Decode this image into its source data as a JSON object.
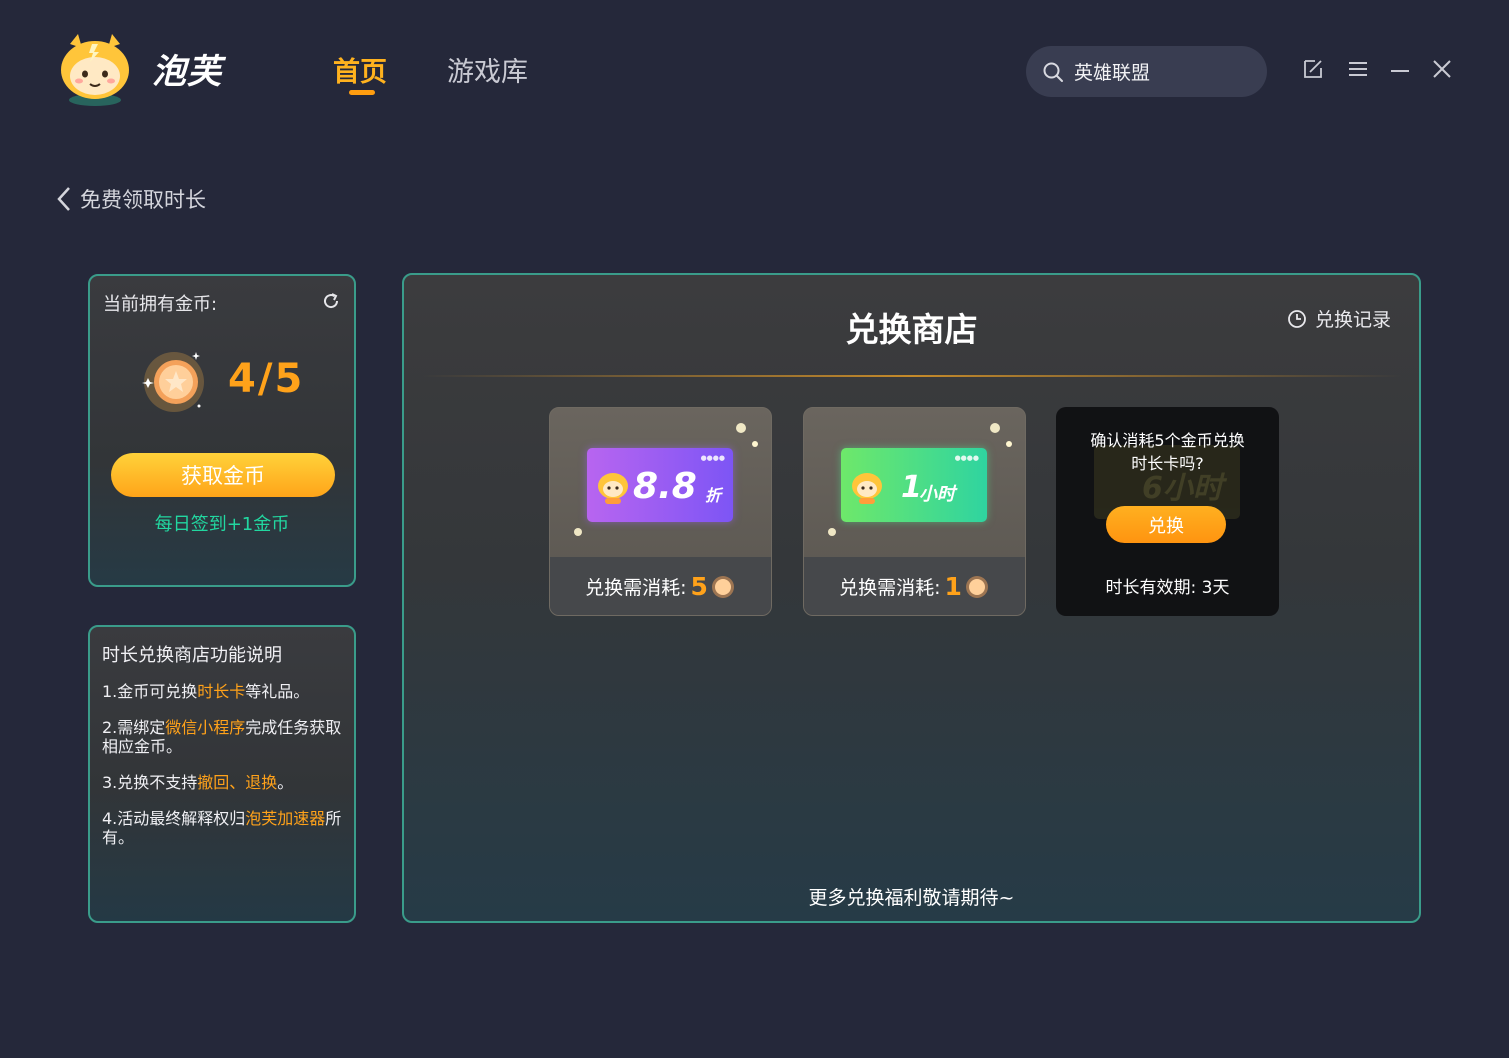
{
  "header": {
    "brand": "泡芙",
    "nav": [
      {
        "label": "首页",
        "active": true
      },
      {
        "label": "游戏库",
        "active": false
      }
    ],
    "search": {
      "value": "英雄联盟",
      "icon": "search-icon"
    },
    "window_controls": [
      "feedback-icon",
      "menu-icon",
      "minimize-icon",
      "close-icon"
    ]
  },
  "breadcrumb": {
    "label": "免费领取时长"
  },
  "coins": {
    "label": "当前拥有金币:",
    "count": "4/5",
    "get_button": "获取金币",
    "daily_hint": "每日签到+1金币"
  },
  "instructions": {
    "title": "时长兑换商店功能说明",
    "items": [
      {
        "pre": "1.金币可兑换",
        "hl": "时长卡",
        "post": "等礼品。"
      },
      {
        "pre": "2.需绑定",
        "hl": "微信小程序",
        "post": "完成任务获取相应金币。"
      },
      {
        "pre": "3.兑换不支持",
        "hl": "撤回、退换",
        "post": "。"
      },
      {
        "pre": "4.活动最终解释权归",
        "hl": "泡芙加速器",
        "post": "所有。"
      }
    ]
  },
  "store": {
    "title": "兑换商店",
    "history_label": "兑换记录",
    "cards": [
      {
        "ticket_value": "8.8",
        "ticket_unit": "折",
        "cost_label": "兑换需消耗:",
        "cost": "5"
      },
      {
        "ticket_value": "1",
        "ticket_unit": "小时",
        "cost_label": "兑换需消耗:",
        "cost": "1"
      }
    ],
    "confirm": {
      "question_line1": "确认消耗5个金币兑换",
      "question_line2": "时长卡吗?",
      "button": "兑换",
      "validity": "时长有效期: 3天",
      "ghost_value": "6小时"
    },
    "footer": "更多兑换福利敬请期待~"
  },
  "colors": {
    "background": "#25283a",
    "accent": "#ffa21a",
    "panel_border": "#3a9c8a",
    "daily_hint": "#22d7a0"
  }
}
